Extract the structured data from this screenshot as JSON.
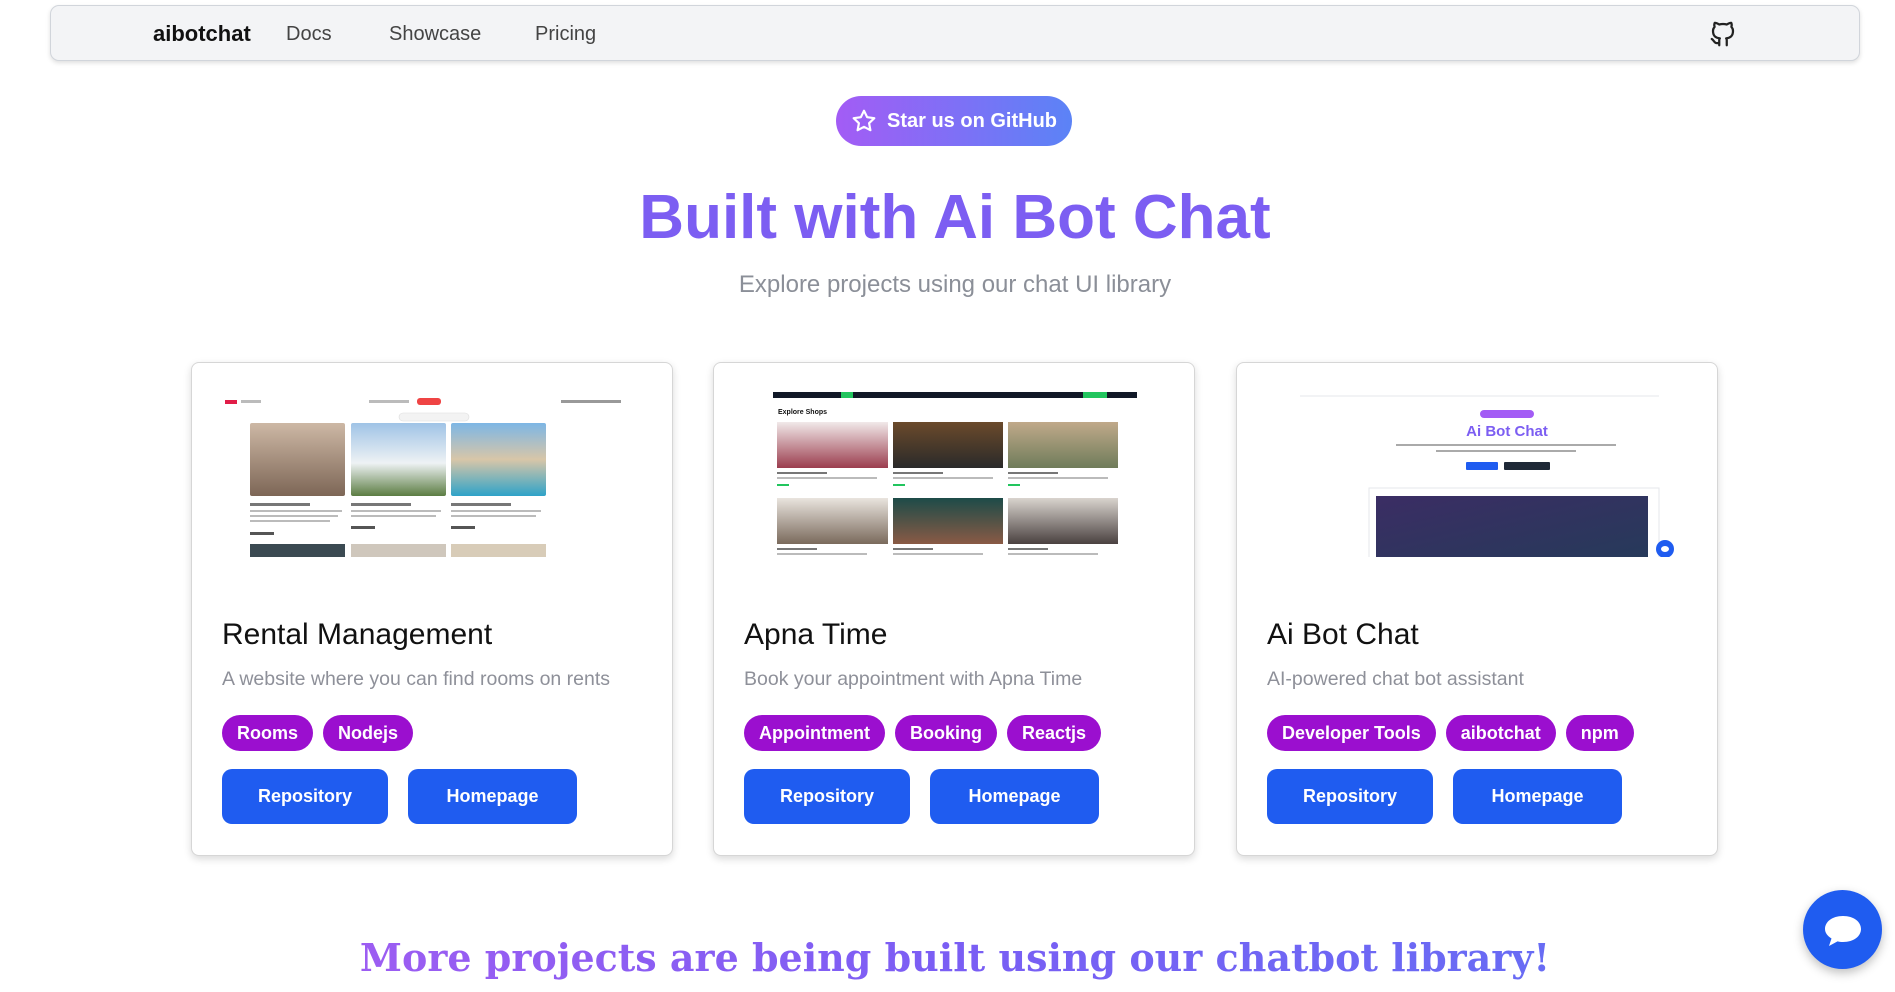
{
  "nav": {
    "brand": "aibotchat",
    "links": [
      "Docs",
      "Showcase",
      "Pricing"
    ],
    "github_icon": "github-icon"
  },
  "hero": {
    "star_button": "Star us on GitHub",
    "title": "Built with Ai Bot Chat",
    "subtitle": "Explore projects using our chat UI library"
  },
  "projects": [
    {
      "title": "Rental Management",
      "description": "A website where you can find rooms on rents",
      "tags": [
        "Rooms",
        "Nodejs"
      ],
      "repo_label": "Repository",
      "home_label": "Homepage"
    },
    {
      "title": "Apna Time",
      "description": "Book your appointment with Apna Time",
      "tags": [
        "Appointment",
        "Booking",
        "Reactjs"
      ],
      "repo_label": "Repository",
      "home_label": "Homepage",
      "preview_heading": "Explore Shops"
    },
    {
      "title": "Ai Bot Chat",
      "description": "AI-powered chat bot assistant",
      "tags": [
        "Developer Tools",
        "aibotchat",
        "npm"
      ],
      "repo_label": "Repository",
      "home_label": "Homepage",
      "preview_heading": "Ai Bot Chat"
    }
  ],
  "footer_line": "More projects are being built using our chatbot library!",
  "colors": {
    "accent_purple": "#7c5ef2",
    "tag_purple": "#9b0fcf",
    "button_blue": "#1f5cf0"
  },
  "chat_widget_icon": "chat-bubble-icon"
}
